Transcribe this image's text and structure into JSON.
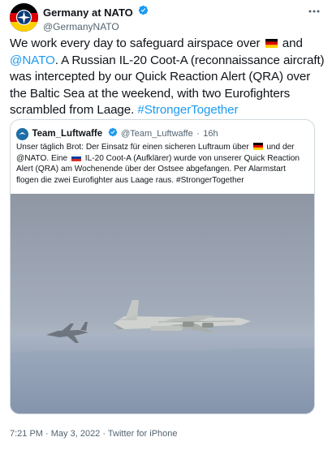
{
  "tweet": {
    "author": {
      "name": "Germany at NATO",
      "handle": "@GermanyNATO"
    },
    "text": {
      "part1": "We work every day to safeguard airspace over",
      "part2": "and",
      "mention": "@NATO",
      "part3": ". A Russian IL-20 Coot-A (reconnaissance aircraft) was intercepted by our Quick Reaction Alert (QRA) over the Baltic Sea at the weekend, with two Eurofighters scrambled from Laage.",
      "hashtag": "#StrongerTogether"
    },
    "footer": {
      "time": "7:21 PM",
      "date": "May 3, 2022",
      "source": "Twitter for iPhone",
      "separator": "·"
    }
  },
  "quoted": {
    "author": {
      "name": "Team_Luftwaffe",
      "handle": "@Team_Luftwaffe",
      "age": "16h",
      "separator": "·"
    },
    "text": {
      "part1": "Unser täglich Brot: Der Einsatz für einen sicheren Luftraum über",
      "part2": "und der @NATO. Eine",
      "part3": "IL-20 Coot-A (Aufklärer) wurde von unserer Quick Reaction Alert (QRA) am Wochenende über der Ostsee abgefangen. Per Alarmstart flogen die zwei Eurofighter aus Laage raus. #StrongerTogether"
    }
  },
  "colors": {
    "link": "#1d9bf0",
    "verified": "#1d9bf0",
    "secondary_text": "#536471",
    "border": "#cfd9de"
  },
  "icons": [
    "nato-germany-avatar",
    "verified-badge-icon",
    "more-options-icon",
    "germany-flag-icon",
    "russia-flag-icon",
    "luftwaffe-avatar"
  ]
}
